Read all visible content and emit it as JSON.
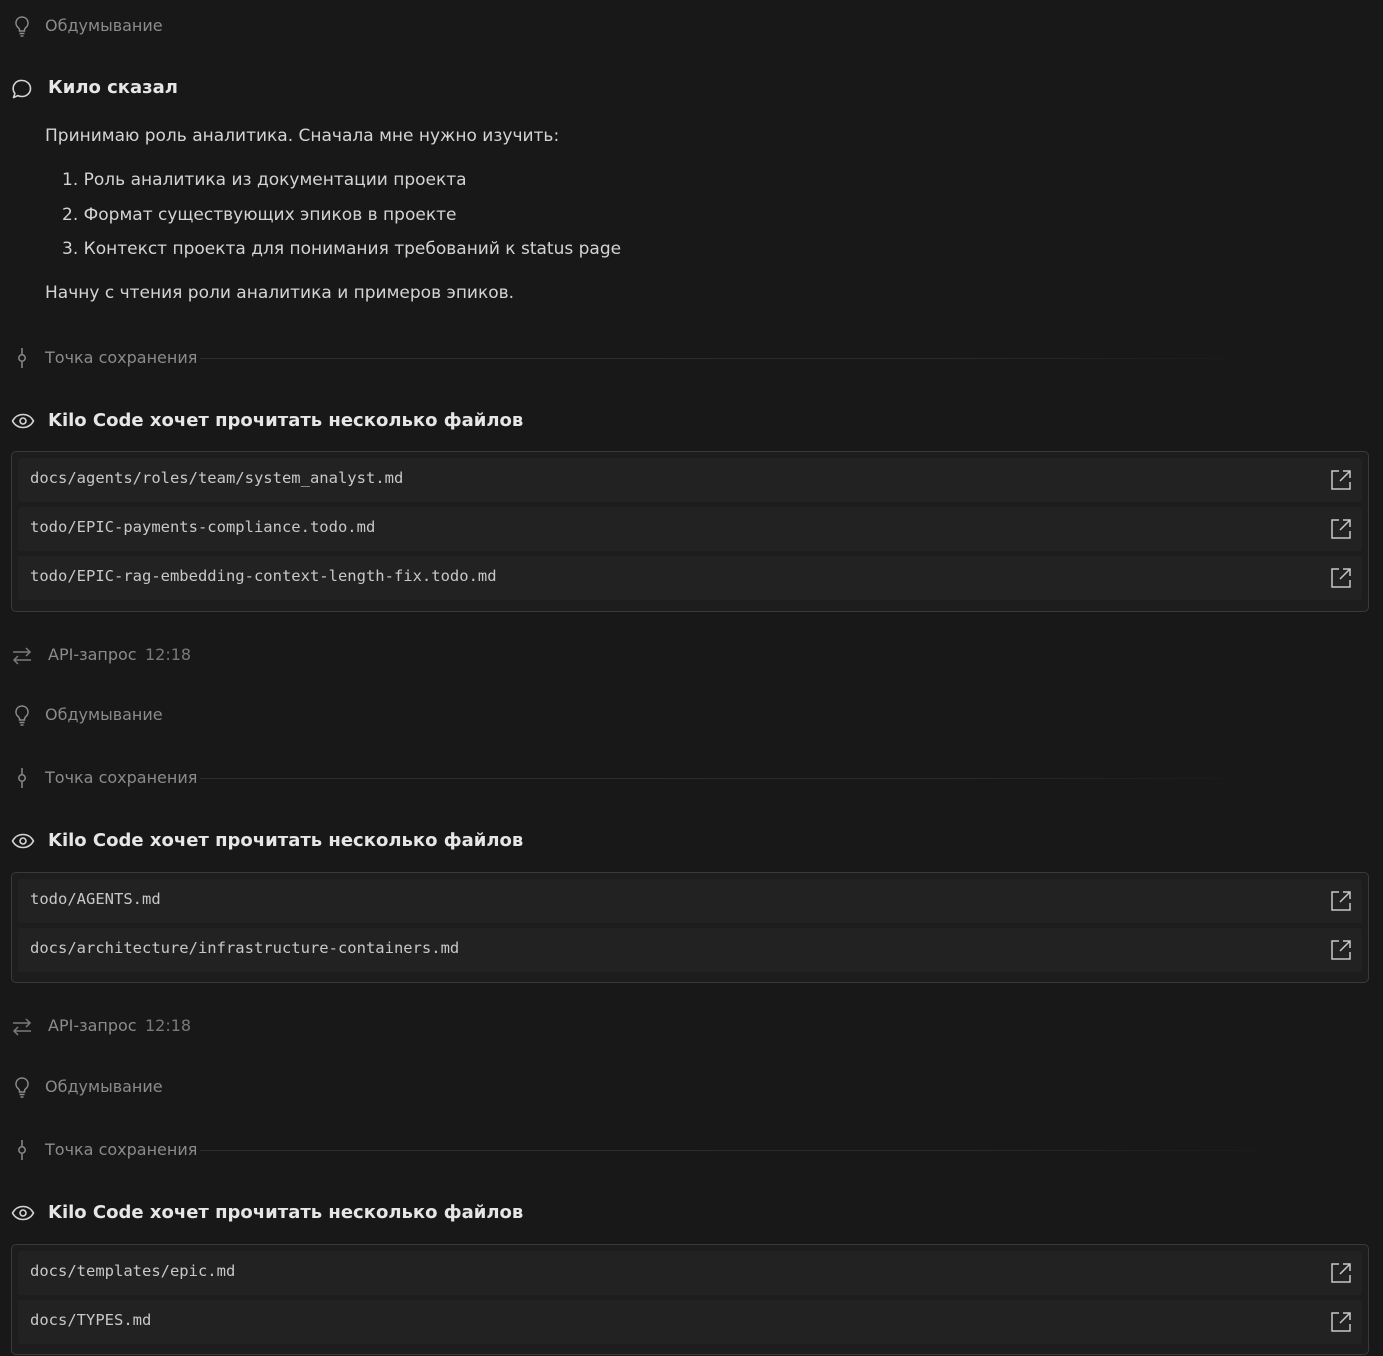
{
  "labels": {
    "thinking": "Обдумывание",
    "checkpoint": "Точка сохранения",
    "api_request": "API-запрос",
    "read_files": "Kilo Code хочет прочитать несколько файлов"
  },
  "message": {
    "title": "Кило сказал",
    "intro": "Принимаю роль аналитика. Сначала мне нужно изучить:",
    "list": [
      "1. Роль аналитика из документации проекта",
      "2. Формат существующих эпиков в проекте",
      "3. Контекст проекта для понимания требований к status page"
    ],
    "outro": "Начну с чтения роли аналитика и примеров эпиков."
  },
  "file_groups": [
    {
      "files": [
        "docs/agents/roles/team/system_analyst.md",
        "todo/EPIC-payments-compliance.todo.md",
        "todo/EPIC-rag-embedding-context-length-fix.todo.md"
      ]
    },
    {
      "files": [
        "todo/AGENTS.md",
        "docs/architecture/infrastructure-containers.md"
      ]
    },
    {
      "files": [
        "docs/templates/epic.md",
        "docs/TYPES.md"
      ]
    }
  ],
  "api_requests": [
    {
      "time": "12:18"
    },
    {
      "time": "12:18"
    }
  ],
  "icons": {
    "thinking": "lightbulb-icon",
    "message": "chat-bubble-icon",
    "checkpoint": "git-commit-icon",
    "read": "eye-icon",
    "api": "arrows-exchange-icon",
    "open": "external-link-icon"
  },
  "colors": {
    "background": "#181818",
    "muted_text": "#8b8b8b",
    "text": "#d4d4d4",
    "title": "#e6e6e6",
    "border": "#3a3a3a"
  }
}
